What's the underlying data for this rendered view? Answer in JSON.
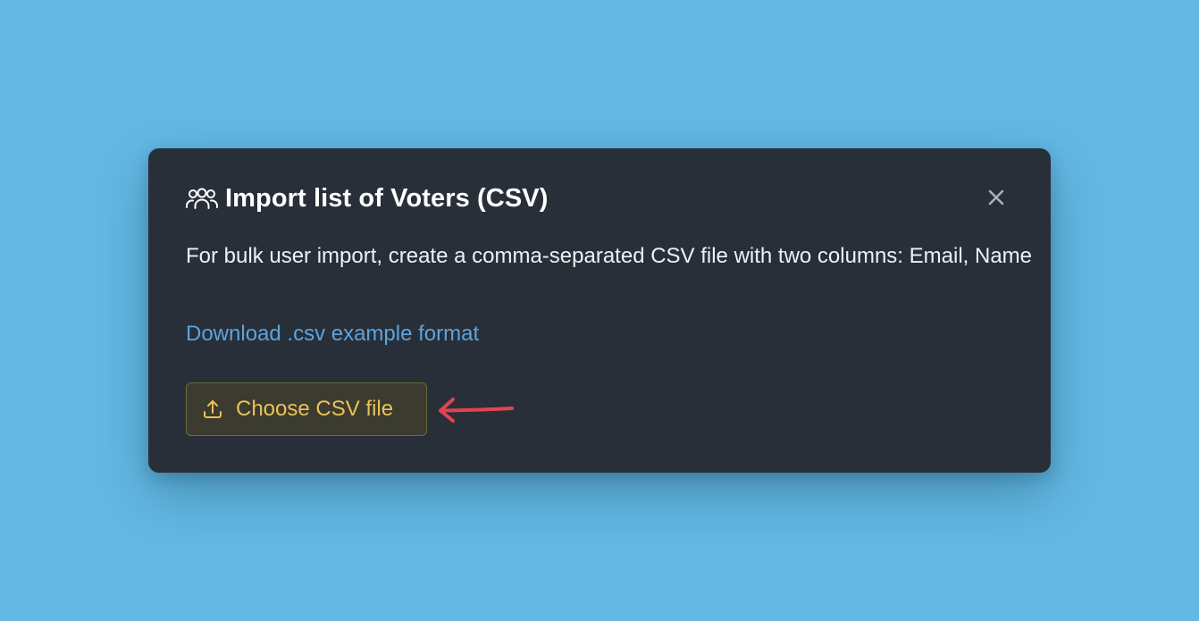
{
  "modal": {
    "title": "Import list of Voters (CSV)",
    "title_icon": "users-icon",
    "close_icon": "close-icon",
    "description": "For bulk user import, create a comma-separated CSV file with two columns: Email, Name",
    "download_link": "Download .csv example format",
    "choose_button": {
      "label": "Choose CSV file",
      "icon": "upload-icon"
    }
  },
  "annotation": {
    "icon": "arrow-left-icon",
    "color": "#e0454f"
  },
  "colors": {
    "background": "#63b9e4",
    "modal_bg": "#282f38",
    "link": "#5ba4dd",
    "button_text": "#e8c25a"
  }
}
